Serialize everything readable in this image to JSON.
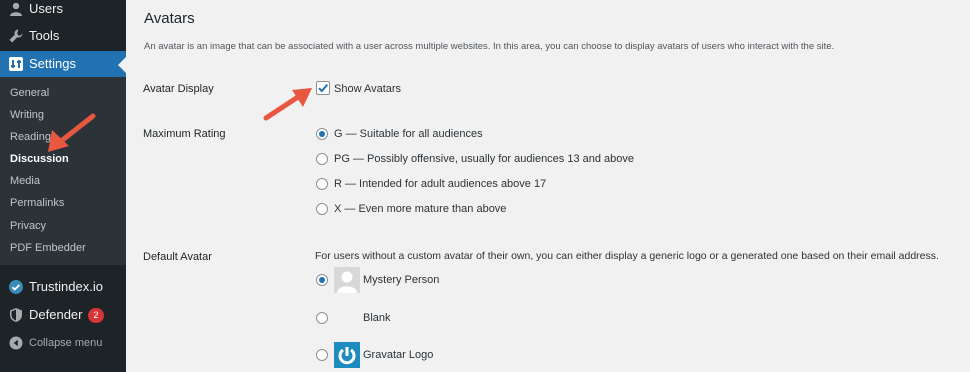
{
  "sidebar": {
    "top_items": [
      {
        "label": "Users",
        "icon": "user-icon"
      },
      {
        "label": "Tools",
        "icon": "wrench-icon"
      },
      {
        "label": "Settings",
        "icon": "settings-icon"
      }
    ],
    "submenu": [
      "General",
      "Writing",
      "Reading",
      "Discussion",
      "Media",
      "Permalinks",
      "Privacy",
      "PDF Embedder"
    ],
    "current_submenu": "Discussion",
    "plugins": [
      {
        "label": "Trustindex.io",
        "icon": "trustindex-icon"
      },
      {
        "label": "Defender",
        "icon": "shield-icon",
        "badge": "2"
      }
    ],
    "collapse_label": "Collapse menu"
  },
  "section": {
    "title": "Avatars",
    "description": "An avatar is an image that can be associated with a user across multiple websites. In this area, you can choose to display avatars of users who interact with the site."
  },
  "avatar_display": {
    "label": "Avatar Display",
    "checkbox_label": "Show Avatars",
    "checked": true
  },
  "max_rating": {
    "label": "Maximum Rating",
    "options": [
      "G — Suitable for all audiences",
      "PG — Possibly offensive, usually for audiences 13 and above",
      "R — Intended for adult audiences above 17",
      "X — Even more mature than above"
    ],
    "selected_index": 0
  },
  "default_avatar": {
    "label": "Default Avatar",
    "description": "For users without a custom avatar of their own, you can either display a generic logo or a generated one based on their email address.",
    "options": [
      "Mystery Person",
      "Blank",
      "Gravatar Logo"
    ],
    "selected_index": 0
  },
  "colors": {
    "sidebar_bg": "#1d2327",
    "submenu_bg": "#2c3338",
    "accent": "#2271b1",
    "badge": "#d63638",
    "arrow": "#e8573f"
  }
}
